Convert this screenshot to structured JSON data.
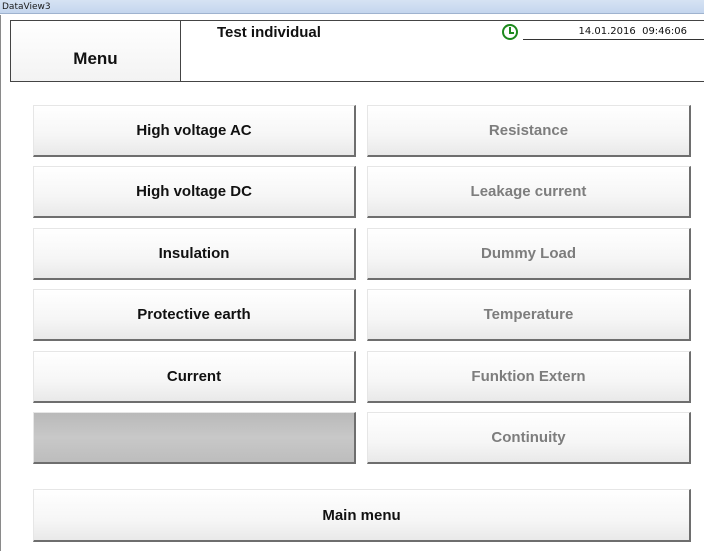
{
  "window": {
    "title": "DataView3"
  },
  "header": {
    "menu_label": "Menu",
    "title": "Test individual",
    "datetime": "14.01.2016  09:46:06"
  },
  "buttons": {
    "left": [
      {
        "label": "High voltage AC",
        "enabled": true
      },
      {
        "label": "High voltage DC",
        "enabled": true
      },
      {
        "label": "Insulation",
        "enabled": true
      },
      {
        "label": "Protective earth",
        "enabled": true
      },
      {
        "label": "Current",
        "enabled": true
      },
      {
        "label": "",
        "enabled": false
      }
    ],
    "right": [
      {
        "label": "Resistance",
        "enabled": false
      },
      {
        "label": "Leakage current",
        "enabled": false
      },
      {
        "label": "Dummy Load",
        "enabled": false
      },
      {
        "label": "Temperature",
        "enabled": false
      },
      {
        "label": "Funktion Extern",
        "enabled": false
      },
      {
        "label": "Continuity",
        "enabled": false
      }
    ],
    "main_menu": "Main menu"
  },
  "colors": {
    "clock_icon": "#1e8a1e",
    "disabled_text": "#7d7d7d",
    "blank_button": "#bdbdbd"
  }
}
